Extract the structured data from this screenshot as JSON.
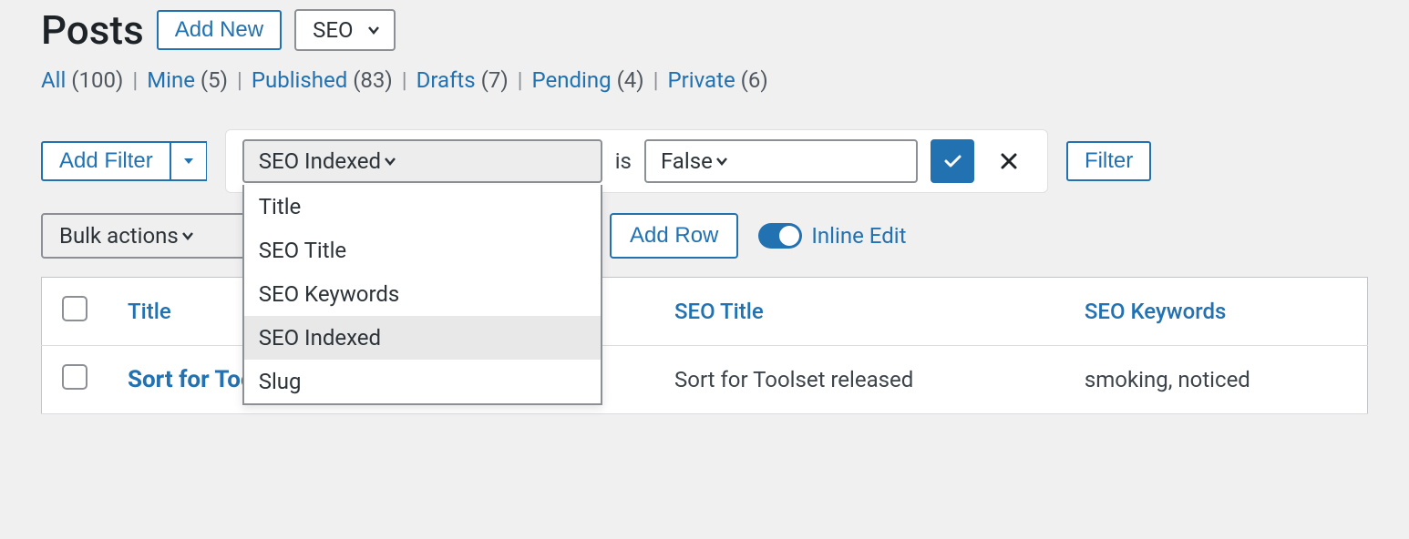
{
  "page_title": "Posts",
  "add_new_label": "Add New",
  "header_select": {
    "value": "SEO"
  },
  "status_links": [
    {
      "label": "All",
      "count": "(100)"
    },
    {
      "label": "Mine",
      "count": "(5)"
    },
    {
      "label": "Published",
      "count": "(83)"
    },
    {
      "label": "Drafts",
      "count": "(7)"
    },
    {
      "label": "Pending",
      "count": "(4)"
    },
    {
      "label": "Private",
      "count": "(6)"
    }
  ],
  "filter": {
    "add_filter_label": "Add Filter",
    "field_select": {
      "selected": "SEO Indexed",
      "options": [
        "Title",
        "SEO Title",
        "SEO Keywords",
        "SEO Indexed",
        "Slug"
      ]
    },
    "operator": "is",
    "value_select": {
      "selected": "False"
    },
    "filter_button": "Filter"
  },
  "actions": {
    "bulk_actions": "Bulk actions",
    "add_row": "Add Row",
    "inline_edit": "Inline Edit"
  },
  "table": {
    "headers": {
      "title": "Title",
      "seo_title": "SEO Title",
      "seo_keywords": "SEO Keywords"
    },
    "row": {
      "title": "Sort for Tools",
      "seo_title": "Sort for Toolset released",
      "seo_keywords": "smoking, noticed"
    }
  }
}
